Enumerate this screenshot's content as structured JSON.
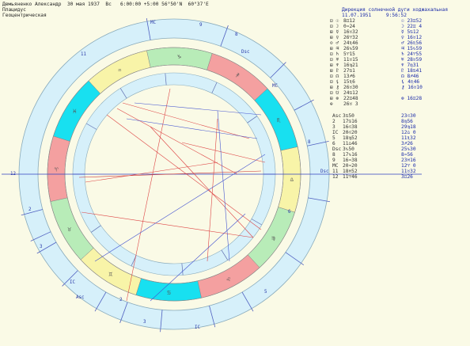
{
  "header": {
    "line1": "Демьяненко Александр  30 мая 1937  Вс   6:00:00 +5:00 56°50'N  60°37'E",
    "line2": "Плацидус",
    "line3": "Геоцентрическая"
  },
  "panel": {
    "title": "Дирекция солнечной дуги ходжахальная",
    "date": "11.07.1951",
    "time": "9:56:52"
  },
  "planets": [
    {
      "sym": "⊡ ☉",
      "natal": "8♊12",
      "dir": "☉ 23♊52"
    },
    {
      "sym": "⊡ ☽",
      "natal": "0♒24",
      "dir": "☽ 22♊ 4"
    },
    {
      "sym": "⊞ ☿",
      "natal": "16♉32",
      "dir": "☿ 5♋12"
    },
    {
      "sym": "⊞ ♀",
      "natal": "26♈32",
      "dir": "♀ 16♉12"
    },
    {
      "sym": "⊙ ♂",
      "natal": "24♏46",
      "dir": "♂ 26♏56"
    },
    {
      "sym": "⊞ ♃",
      "natal": "26♑59",
      "dir": "♃ 15♑59"
    },
    {
      "sym": "⊡ ♄",
      "natal": "5♈15",
      "dir": "♄ 24♈55"
    },
    {
      "sym": "⊡ ♅",
      "natal": "11♉15",
      "dir": "♅ 28♉59"
    },
    {
      "sym": "⊞ ♆",
      "natal": "16♍21",
      "dir": "♆ 7♍31"
    },
    {
      "sym": "⊞ ♇",
      "natal": "27♋1",
      "dir": "♇ 18♋41"
    },
    {
      "sym": "⊡ ☊",
      "natal": "13♐6",
      "dir": "☊ 8♐46"
    },
    {
      "sym": "⊡ ⚸",
      "natal": "15♏6",
      "dir": "⚸ 4♏46"
    },
    {
      "sym": "⊞ ⚷",
      "natal": "26♉30",
      "dir": "⚷ 16♉10"
    },
    {
      "sym": "⊡ ☋",
      "natal": "24♋12",
      "dir": ""
    },
    {
      "sym": "⊞ ⊗",
      "natal": "22♊48",
      "dir": "⊗ 16♊28"
    },
    {
      "sym": "⊕",
      "natal": "26♉ 3",
      "dir": ""
    }
  ],
  "houses": [
    {
      "name": "Asc",
      "natal": "3♋50",
      "dir": "23♌30"
    },
    {
      "name": "2",
      "natal": "17♋16",
      "dir": "8♍56"
    },
    {
      "name": "3",
      "natal": "16♌38",
      "dir": "29♍18"
    },
    {
      "name": "IC",
      "natal": "20♌20",
      "dir": "12♎ 0"
    },
    {
      "name": "5",
      "natal": "18♍52",
      "dir": "11♏32"
    },
    {
      "name": "6",
      "natal": "11♎46",
      "dir": "3♐26"
    },
    {
      "name": "Dsc",
      "natal": "3♑50",
      "dir": "25♑30"
    },
    {
      "name": "8",
      "natal": "17♑16",
      "dir": "8♒56"
    },
    {
      "name": "9",
      "natal": "16♒38",
      "dir": "23♓16"
    },
    {
      "name": "MC",
      "natal": "20♒20",
      "dir": "12♈ 0"
    },
    {
      "name": "11",
      "natal": "18♓52",
      "dir": "11♉32"
    },
    {
      "name": "12",
      "natal": "11♈46",
      "dir": "3♊26"
    }
  ],
  "zodiac": {
    "signs": [
      "♈",
      "♉",
      "♊",
      "♋",
      "♌",
      "♍",
      "♎",
      "♏",
      "♐",
      "♑",
      "♒",
      "♓"
    ],
    "colors": {
      "fire": "#f4a0a0",
      "earth": "#b8ecb8",
      "air": "#f8f4a8",
      "water": "#18e0f0"
    }
  },
  "wheel_labels": [
    {
      "text": "MC",
      "name": "natal-mc-label"
    },
    {
      "text": "9",
      "name": "house-9-label"
    },
    {
      "text": "8",
      "name": "house-8-label"
    },
    {
      "text": "11",
      "name": "house-11-label"
    },
    {
      "text": "Dsc",
      "name": "dsc-label"
    },
    {
      "text": "MC",
      "name": "directed-mc-label"
    },
    {
      "text": "8",
      "name": "house-8b-label"
    },
    {
      "text": "12",
      "name": "house-12-label"
    },
    {
      "text": "Dsc",
      "name": "directed-dsc-label"
    },
    {
      "text": "6",
      "name": "house-6-label"
    },
    {
      "text": "5",
      "name": "house-5-label"
    },
    {
      "text": "2",
      "name": "house-2-label"
    },
    {
      "text": "3",
      "name": "house-3-label"
    },
    {
      "text": "IC",
      "name": "ic-label"
    },
    {
      "text": "Asc",
      "name": "asc-label"
    },
    {
      "text": "IC",
      "name": "directed-ic-label"
    },
    {
      "text": "2",
      "name": "house-2b-label"
    },
    {
      "text": "3",
      "name": "house-3b-label"
    }
  ]
}
